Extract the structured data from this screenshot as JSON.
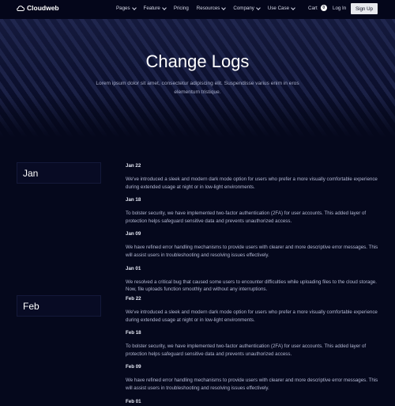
{
  "nav": {
    "brand": "Cloudweb",
    "menu": [
      {
        "label": "Pages",
        "dropdown": true
      },
      {
        "label": "Feature",
        "dropdown": true
      },
      {
        "label": "Pricing",
        "dropdown": false
      },
      {
        "label": "Resources",
        "dropdown": true
      },
      {
        "label": "Company",
        "dropdown": true
      },
      {
        "label": "Use Case",
        "dropdown": true
      }
    ],
    "cart_label": "Cart",
    "cart_count": "0",
    "login_label": "Log In",
    "signup_label": "Sign Up"
  },
  "hero": {
    "title": "Change Logs",
    "subtitle": "Lorem ipsum dolor sit amet, consectetur adipiscing elit. Suspendisse varius enim in eros elementum tristique."
  },
  "months": [
    {
      "name": "Jan",
      "entries": [
        {
          "date": "Jan 22",
          "text": "We've introduced a sleek and modern dark mode option for users who prefer a more visually comfortable experience during extended usage at night or in low-light environments."
        },
        {
          "date": "Jan 18",
          "text": "To bolster security, we have implemented two-factor authentication (2FA) for user accounts. This added layer of protection helps safeguard sensitive data and prevents unauthorized access."
        },
        {
          "date": "Jan 09",
          "text": "We have refined error handling mechanisms to provide users with clearer and more descriptive error messages. This will assist users in troubleshooting and resolving issues effectively."
        },
        {
          "date": "Jan 01",
          "text": "We resolved a critical bug that caused some users to encounter difficulties while uploading files to the cloud storage. Now, file uploads function smoothly and without any interruptions."
        }
      ]
    },
    {
      "name": "Feb",
      "entries": [
        {
          "date": "Feb 22",
          "text": "We've introduced a sleek and modern dark mode option for users who prefer a more visually comfortable experience during extended usage at night or in low-light environments."
        },
        {
          "date": "Feb 18",
          "text": "To bolster security, we have implemented two-factor authentication (2FA) for user accounts. This added layer of protection helps safeguard sensitive data and prevents unauthorized access."
        },
        {
          "date": "Feb 09",
          "text": "We have refined error handling mechanisms to provide users with clearer and more descriptive error messages. This will assist users in troubleshooting and resolving issues effectively."
        },
        {
          "date": "Feb 01",
          "text": ""
        }
      ]
    }
  ],
  "colors": {
    "background": "#05081c",
    "accent": "#e8e9ee"
  }
}
